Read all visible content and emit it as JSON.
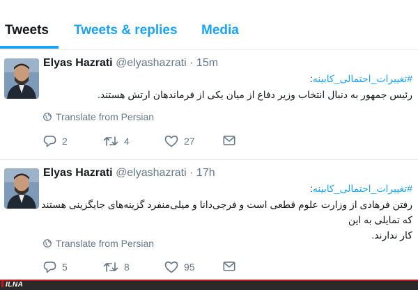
{
  "tabs": [
    {
      "label": "Tweets"
    },
    {
      "label": "Tweets & replies"
    },
    {
      "label": "Media"
    }
  ],
  "tweets": [
    {
      "name": "Elyas Hazrati",
      "handle": "@elyashazrati",
      "separator": "·",
      "time": "15m",
      "hashtag": "#تغییرات_احتمالی_کابینه",
      "hashtag_colon": ":",
      "lines": [
        "رئیس جمهور به دنبال انتخاب وزیر دفاع از میان یکی از فرماندهان ارتش هستند."
      ],
      "translate_label": "Translate from Persian",
      "replies": "2",
      "retweets": "4",
      "likes": "27"
    },
    {
      "name": "Elyas Hazrati",
      "handle": "@elyashazrati",
      "separator": "·",
      "time": "17h",
      "hashtag": "#تغییرات_احتمالی_کابینه",
      "hashtag_colon": ":",
      "lines": [
        "رفتن فرهادی از وزارت علوم قطعی است و فرجی‌دانا و میلی‌منفرد گزینه‌های جایگزینی هستند که تمایلی به این",
        "کار ندارند."
      ],
      "translate_label": "Translate from Persian",
      "replies": "5",
      "retweets": "8",
      "likes": "95"
    }
  ],
  "watermark": "ILNA",
  "colors": {
    "accent": "#1da1f2",
    "muted": "#657786",
    "text": "#14171a",
    "border": "#e6ecf0"
  },
  "icons": [
    "reply-icon",
    "retweet-icon",
    "like-icon",
    "message-icon",
    "globe-icon"
  ]
}
